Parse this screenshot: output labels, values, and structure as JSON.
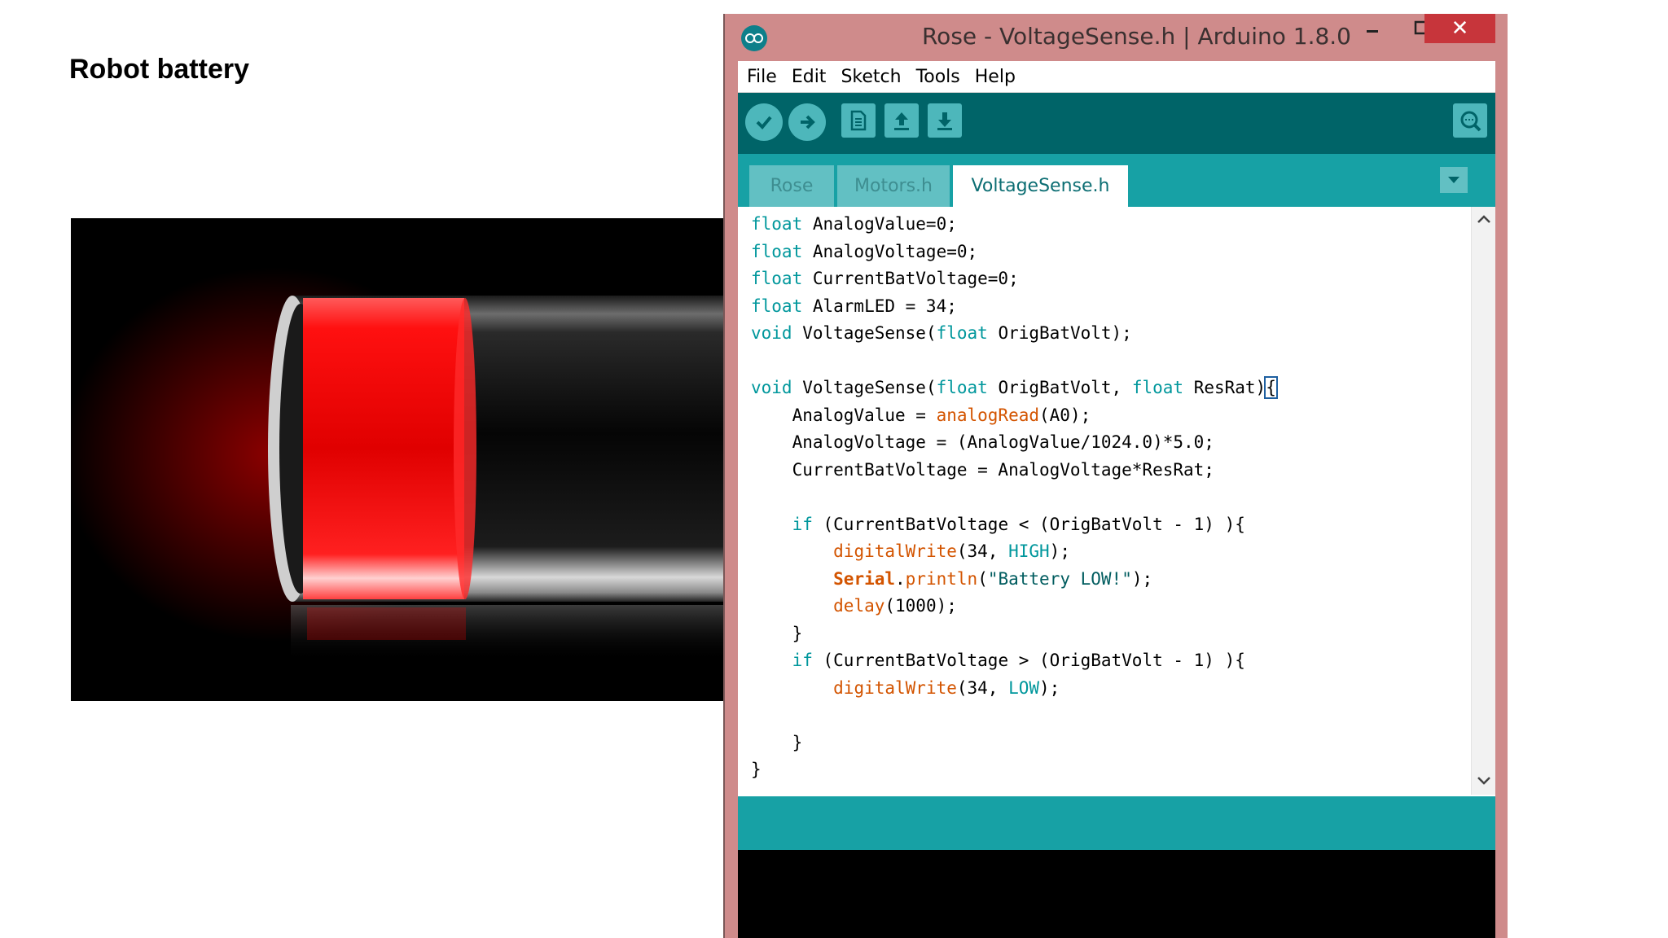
{
  "slide": {
    "title": "Robot battery"
  },
  "battery": {
    "level_color": "#ff0000",
    "image_label": "battery-low-image"
  },
  "window": {
    "title": "Rose - VoltageSense.h | Arduino 1.8.0",
    "close_glyph": "✕",
    "colors": {
      "frame": "#cf8b8b",
      "toolbar": "#006468",
      "tabbar": "#17a1a5",
      "close": "#c7353b"
    }
  },
  "menu": {
    "items": [
      "File",
      "Edit",
      "Sketch",
      "Tools",
      "Help"
    ]
  },
  "toolbar": {
    "buttons": [
      "verify-icon",
      "upload-icon",
      "new-icon",
      "open-icon",
      "save-icon",
      "serial-monitor-icon"
    ]
  },
  "tabs": [
    {
      "label": "Rose",
      "active": false
    },
    {
      "label": "Motors.h",
      "active": false
    },
    {
      "label": "VoltageSense.h",
      "active": true
    }
  ],
  "code": {
    "lines": [
      [
        {
          "t": "float",
          "c": "kw"
        },
        {
          "t": " AnalogValue=0;"
        }
      ],
      [
        {
          "t": "float",
          "c": "kw"
        },
        {
          "t": " AnalogVoltage=0;"
        }
      ],
      [
        {
          "t": "float",
          "c": "kw"
        },
        {
          "t": " CurrentBatVoltage=0;"
        }
      ],
      [
        {
          "t": "float",
          "c": "kw"
        },
        {
          "t": " AlarmLED = 34;"
        }
      ],
      [
        {
          "t": "void",
          "c": "kw"
        },
        {
          "t": " VoltageSense("
        },
        {
          "t": "float",
          "c": "kw"
        },
        {
          "t": " OrigBatVolt);"
        }
      ],
      [],
      [
        {
          "t": "void",
          "c": "kw"
        },
        {
          "t": " VoltageSense("
        },
        {
          "t": "float",
          "c": "kw"
        },
        {
          "t": " OrigBatVolt, "
        },
        {
          "t": "float",
          "c": "kw"
        },
        {
          "t": " ResRat)"
        },
        {
          "t": "{",
          "c": "cursor-brace"
        }
      ],
      [
        {
          "t": "    AnalogValue = "
        },
        {
          "t": "analogRead",
          "c": "fn"
        },
        {
          "t": "(A0);"
        }
      ],
      [
        {
          "t": "    AnalogVoltage = (AnalogValue/1024.0)*5.0;"
        }
      ],
      [
        {
          "t": "    CurrentBatVoltage = AnalogVoltage*ResRat;"
        }
      ],
      [],
      [
        {
          "t": "    "
        },
        {
          "t": "if",
          "c": "kw"
        },
        {
          "t": " (CurrentBatVoltage < (OrigBatVolt - 1) ){"
        }
      ],
      [
        {
          "t": "        "
        },
        {
          "t": "digitalWrite",
          "c": "fn"
        },
        {
          "t": "(34, "
        },
        {
          "t": "HIGH",
          "c": "cst"
        },
        {
          "t": ");"
        }
      ],
      [
        {
          "t": "        "
        },
        {
          "t": "Serial",
          "c": "ser"
        },
        {
          "t": "."
        },
        {
          "t": "println",
          "c": "fn"
        },
        {
          "t": "("
        },
        {
          "t": "\"Battery LOW!\"",
          "c": "str"
        },
        {
          "t": ");"
        }
      ],
      [
        {
          "t": "        "
        },
        {
          "t": "delay",
          "c": "fn"
        },
        {
          "t": "(1000);"
        }
      ],
      [
        {
          "t": "    }"
        }
      ],
      [
        {
          "t": "    "
        },
        {
          "t": "if",
          "c": "kw"
        },
        {
          "t": " (CurrentBatVoltage > (OrigBatVolt - 1) ){"
        }
      ],
      [
        {
          "t": "        "
        },
        {
          "t": "digitalWrite",
          "c": "fn"
        },
        {
          "t": "(34, "
        },
        {
          "t": "LOW",
          "c": "cst"
        },
        {
          "t": ");"
        }
      ],
      [],
      [
        {
          "t": "    }"
        }
      ],
      [
        {
          "t": "}"
        }
      ]
    ]
  }
}
